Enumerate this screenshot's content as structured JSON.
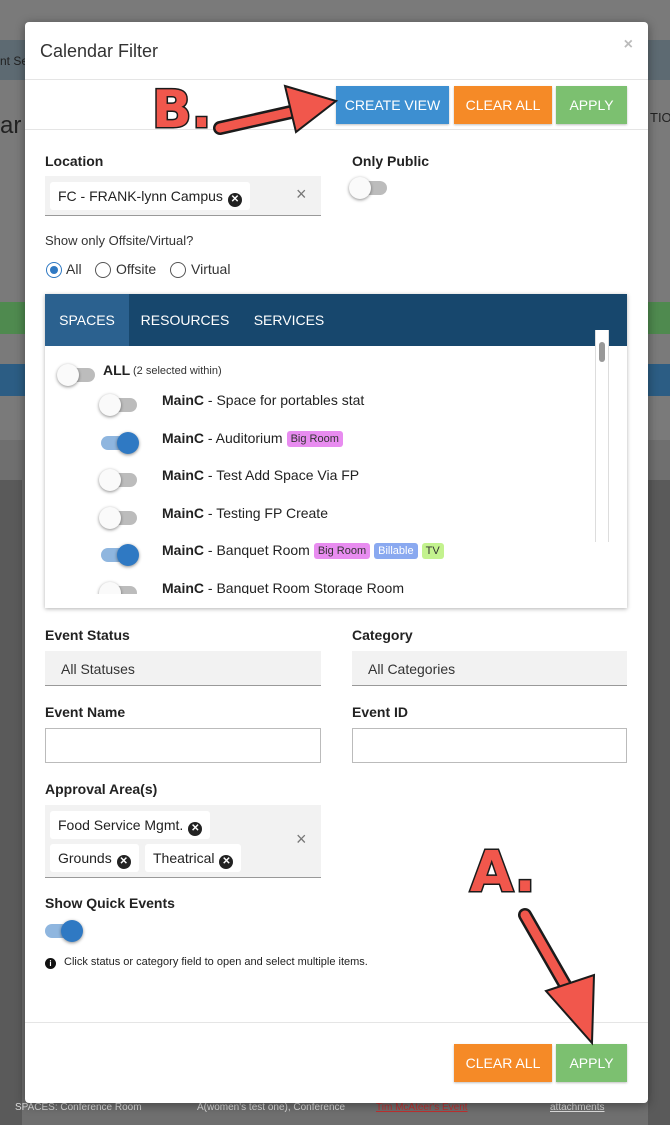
{
  "background": {
    "top_text": "nt Se",
    "title_fragment": "ar",
    "right_fragment": "TIO",
    "bottom_texts": [
      "SPACES: Conference Room",
      "A(women's test one), Conference",
      "Tim McAteer's Event",
      "attachments"
    ]
  },
  "modal": {
    "title": "Calendar Filter",
    "close_glyph": "×",
    "top_buttons": {
      "create_view": "CREATE VIEW",
      "clear_all": "CLEAR ALL",
      "apply": "APPLY"
    },
    "location": {
      "label": "Location",
      "chips": [
        "FC - FRANK-lynn Campus"
      ],
      "clear_glyph": "×"
    },
    "only_public": {
      "label": "Only Public",
      "on": false
    },
    "offsite": {
      "label": "Show only Offsite/Virtual?",
      "options": [
        "All",
        "Offsite",
        "Virtual"
      ],
      "selected": "All"
    },
    "tabs": [
      "SPACES",
      "RESOURCES",
      "SERVICES"
    ],
    "active_tab": "SPACES",
    "spaces": {
      "all_label": "ALL",
      "all_note": "(2 selected within)",
      "items": [
        {
          "code": "MainC",
          "name": " - Space for portables stat",
          "on": false,
          "badges": []
        },
        {
          "code": "MainC",
          "name": " - Auditorium",
          "on": true,
          "badges": [
            {
              "text": "Big Room",
              "color": "#e88cf0"
            }
          ]
        },
        {
          "code": "MainC",
          "name": " - Test Add Space Via FP",
          "on": false,
          "badges": []
        },
        {
          "code": "MainC",
          "name": " - Testing FP Create",
          "on": false,
          "badges": []
        },
        {
          "code": "MainC",
          "name": " - Banquet Room",
          "on": true,
          "badges": [
            {
              "text": "Big Room",
              "color": "#e88cf0"
            },
            {
              "text": "Billable",
              "color": "#8aa9f0"
            },
            {
              "text": "TV",
              "color": "#c3f28e"
            }
          ]
        },
        {
          "code": "MainC",
          "name": " - Banquet Room Storage Room",
          "on": false,
          "badges": []
        }
      ]
    },
    "event_status": {
      "label": "Event Status",
      "value": "All Statuses"
    },
    "category": {
      "label": "Category",
      "value": "All Categories"
    },
    "event_name": {
      "label": "Event Name",
      "value": ""
    },
    "event_id": {
      "label": "Event ID",
      "value": ""
    },
    "approval_areas": {
      "label": "Approval Area(s)",
      "chips": [
        "Food Service Mgmt.",
        "Grounds",
        "Theatrical"
      ],
      "clear_glyph": "×"
    },
    "quick_events": {
      "label": "Show Quick Events",
      "on": true
    },
    "info_text": "Click status or category field to open and select multiple items.",
    "footer_buttons": {
      "clear_all": "CLEAR ALL",
      "apply": "APPLY"
    }
  },
  "annotations": {
    "a": "A.",
    "b": "B.",
    "color": "#f1574c"
  }
}
